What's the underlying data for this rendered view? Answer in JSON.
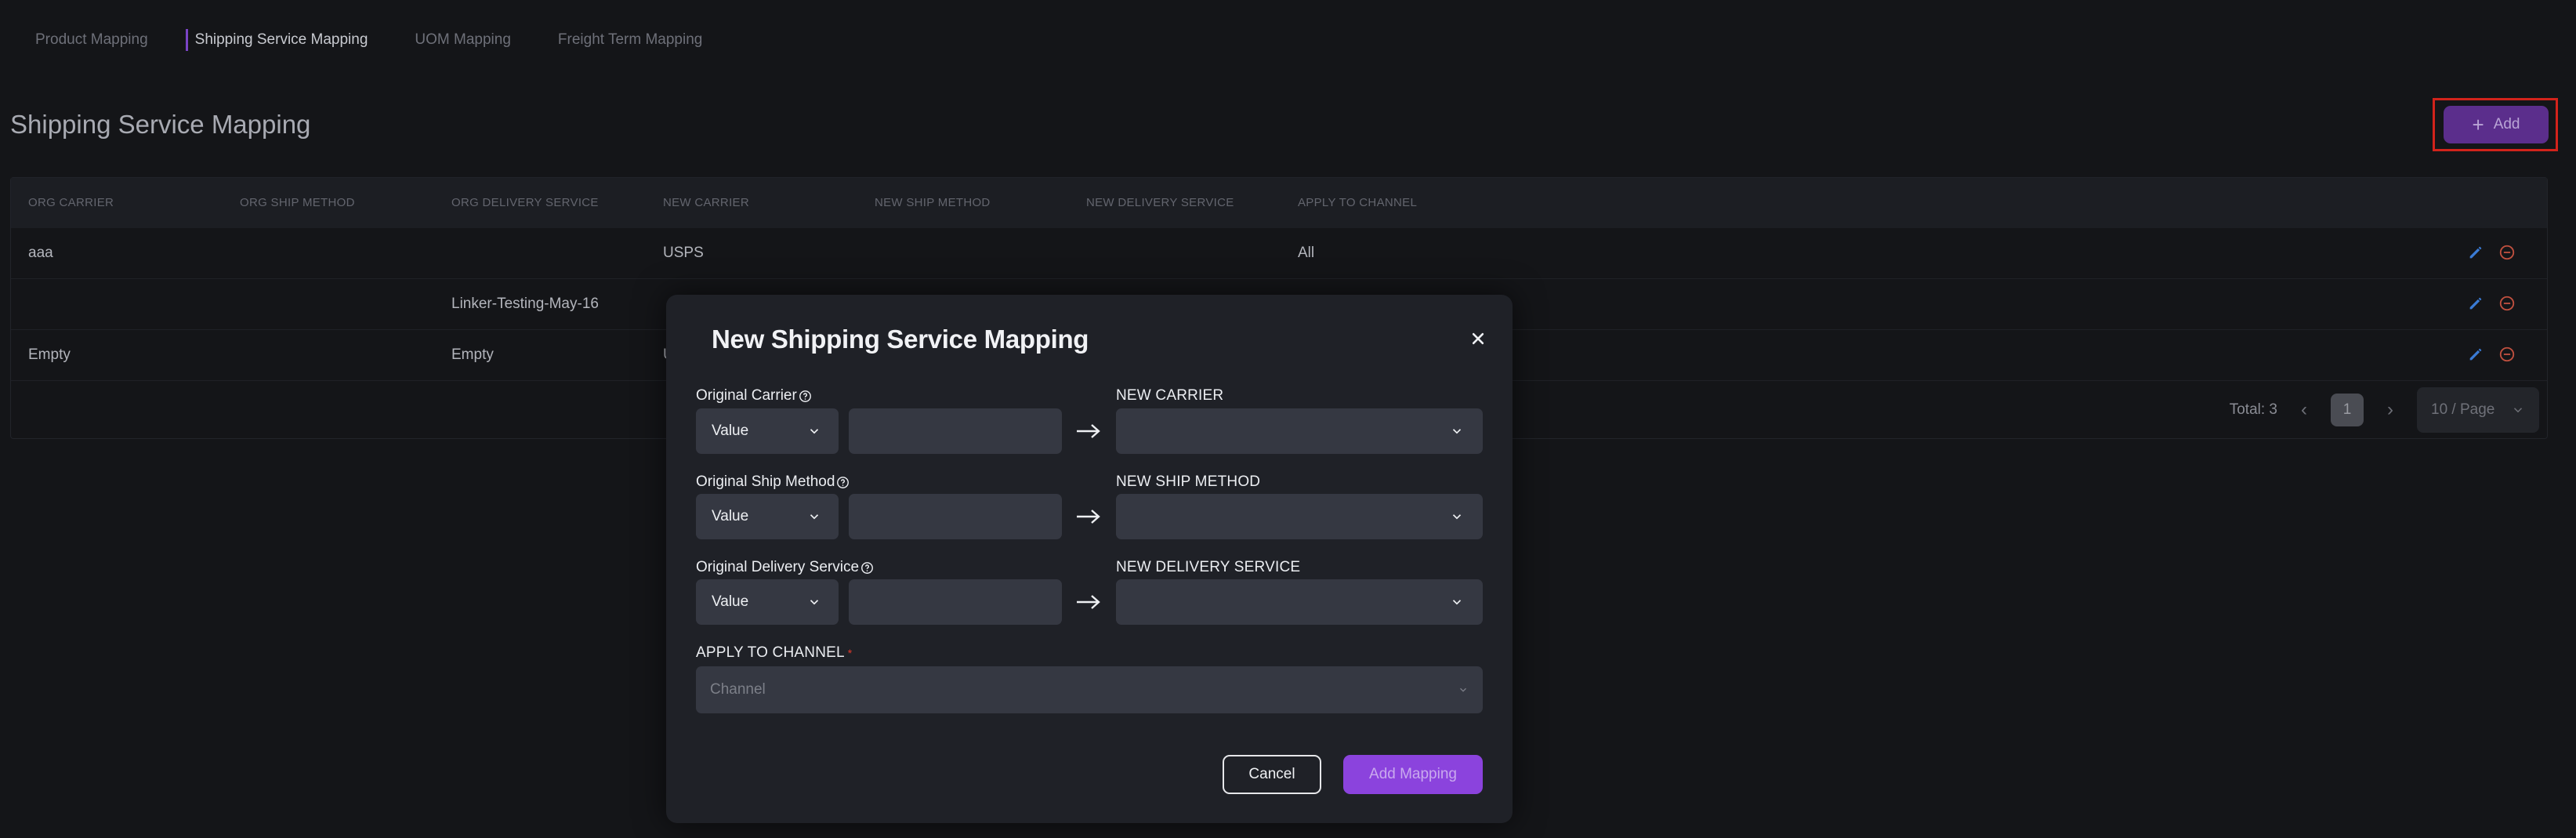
{
  "tabs": [
    {
      "label": "Product Mapping"
    },
    {
      "label": "Shipping Service Mapping"
    },
    {
      "label": "UOM Mapping"
    },
    {
      "label": "Freight Term Mapping"
    }
  ],
  "page": {
    "title": "Shipping Service Mapping",
    "add_label": "Add"
  },
  "table": {
    "columns": [
      "ORG CARRIER",
      "ORG SHIP METHOD",
      "ORG DELIVERY SERVICE",
      "NEW CARRIER",
      "NEW SHIP METHOD",
      "NEW DELIVERY SERVICE",
      "APPLY TO CHANNEL"
    ],
    "rows": [
      {
        "org_carrier": "aaa",
        "org_ship_method": "",
        "org_delivery_service": "",
        "new_carrier": "USPS",
        "new_ship_method": "",
        "new_delivery_service": "",
        "apply_to_channel": "All"
      },
      {
        "org_carrier": "",
        "org_ship_method": "",
        "org_delivery_service": "Linker-Testing-May-16",
        "new_carrier": "",
        "new_ship_method": "",
        "new_delivery_service": "",
        "apply_to_channel": ""
      },
      {
        "org_carrier": "Empty",
        "org_ship_method": "",
        "org_delivery_service": "Empty",
        "new_carrier": "U",
        "new_ship_method": "",
        "new_delivery_service": "",
        "apply_to_channel": ""
      }
    ]
  },
  "pagination": {
    "total_text": "Total: 3",
    "current_page": "1",
    "page_size": "10 / Page"
  },
  "modal": {
    "title": "New Shipping Service Mapping",
    "original_carrier_label": "Original Carrier",
    "original_ship_method_label": "Original Ship Method",
    "original_delivery_service_label": "Original Delivery Service",
    "value_select": "Value",
    "new_carrier_label": "NEW CARRIER",
    "new_ship_method_label": "NEW SHIP METHOD",
    "new_delivery_service_label": "NEW DELIVERY SERVICE",
    "apply_to_channel_label": "APPLY TO CHANNEL",
    "required_mark": "*",
    "channel_placeholder": "Channel",
    "cancel_label": "Cancel",
    "add_mapping_label": "Add Mapping"
  },
  "colors": {
    "accent": "#8b43dd",
    "add_button": "#5b2e8c",
    "highlight_box": "#d2231b",
    "edit_icon": "#3a7bd5",
    "remove_icon": "#c0503f"
  }
}
